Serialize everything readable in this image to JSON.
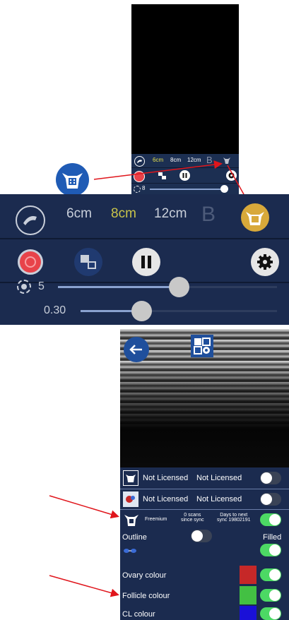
{
  "small_panel": {
    "sizes": [
      "6cm",
      "8cm",
      "12cm"
    ],
    "mode": "B",
    "gain_value": "8"
  },
  "big_panel": {
    "sizes": [
      "6cm",
      "8cm",
      "12cm"
    ],
    "selected_size": "8cm",
    "mode": "B",
    "gain_value": "5",
    "gain_level": 0.55,
    "contrast_value": "0.30",
    "contrast_level": 0.31
  },
  "settings": {
    "row1": {
      "left": "Not Licensed",
      "right": "Not Licensed",
      "on": false
    },
    "row2": {
      "left": "Not Licensed",
      "right": "Not Licensed",
      "on": false
    },
    "row3": {
      "plan": "Freemium",
      "scans": "0 scans\nsince sync",
      "days": "Days to next\nsync 19802191",
      "on": true
    },
    "outline_label": "Outline",
    "filled_label": "Filled",
    "ovary_label": "Ovary colour",
    "follicle_label": "Follicle colour",
    "cl_label": "CL colour"
  },
  "colors": {
    "panel_bg": "#1b2b4f",
    "selected_size": "#c9c44a",
    "record_red": "#e8434a",
    "toggle_on": "#4cd964",
    "ovary": "#c62828",
    "follicle": "#43c043",
    "cl": "#1a10d8",
    "arrow_red": "#e0161c"
  },
  "icons": [
    "cow-head-icon",
    "probe-icon",
    "record-icon",
    "frames-icon",
    "pause-icon",
    "gear-icon",
    "back-arrow-icon",
    "puzzle-gear-icon",
    "ovary-icon"
  ]
}
